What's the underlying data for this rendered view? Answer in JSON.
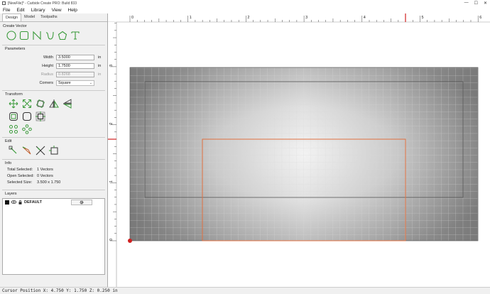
{
  "window": {
    "title": "[NewFile]* - Carbide Create PRO: Build 833",
    "minimize": "—",
    "maximize": "☐",
    "close": "✕"
  },
  "menu": [
    {
      "label": "File"
    },
    {
      "label": "Edit"
    },
    {
      "label": "Library"
    },
    {
      "label": "View"
    },
    {
      "label": "Help"
    }
  ],
  "tabs": [
    {
      "label": "Design",
      "active": true
    },
    {
      "label": "Model"
    },
    {
      "label": "Toolpaths"
    }
  ],
  "create_vector": {
    "title": "Create Vector",
    "icons": [
      "circle-icon",
      "rectangle-icon",
      "polyline-icon",
      "curve-icon",
      "polygon-icon",
      "text-icon"
    ]
  },
  "parameters": {
    "title": "Parameters",
    "width": {
      "label": "Width",
      "value": "3.5000",
      "unit": "in"
    },
    "height": {
      "label": "Height",
      "value": "1.7500",
      "unit": "in"
    },
    "radius": {
      "label": "Radius",
      "value": "0.8268",
      "unit": "in"
    },
    "corners": {
      "label": "Corners",
      "value": "Square"
    }
  },
  "transform": {
    "title": "Transform",
    "row1": [
      "move-icon",
      "scale-icon",
      "rotate-icon",
      "mirror-icon",
      "flip-icon"
    ],
    "row2": [
      "offset-icon",
      "boolean-icon",
      "align-icon"
    ],
    "row3": [
      "array-icon",
      "circular-array-icon"
    ]
  },
  "edit": {
    "title": "Edit",
    "icons": [
      "node-edit-icon",
      "knife-icon",
      "trim-icon",
      "join-icon"
    ]
  },
  "info": {
    "title": "Info",
    "total_selected": {
      "label": "Total Selected:",
      "value": "1 Vectors"
    },
    "open_selected": {
      "label": "Open Selected:",
      "value": "0 Vectors"
    },
    "selected_size": {
      "label": "Selected Size:",
      "value": "3.500 x 1.750"
    }
  },
  "layers": {
    "title": "Layers",
    "items": [
      {
        "name": "DEFAULT",
        "color": "#111111"
      }
    ]
  },
  "ruler": {
    "x_ticks": [
      "0",
      "1",
      "2",
      "3",
      "4",
      "5",
      "6"
    ],
    "y_ticks": [
      "3",
      "2",
      "1",
      "0"
    ]
  },
  "status": {
    "text": "Cursor Position X: 4.750 Y: 1.750 Z: 0.250 in"
  },
  "colors": {
    "accent": "#3a9a3a",
    "selection": "#e07040",
    "cursor_marker": "#d02020"
  }
}
